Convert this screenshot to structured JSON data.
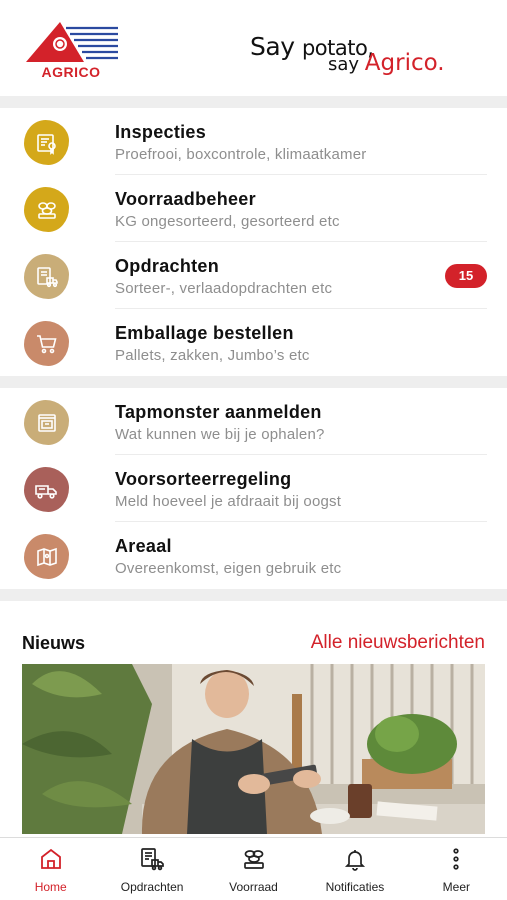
{
  "brand": {
    "logo_text": "AGRICO",
    "slogan_line1_a": "Say",
    "slogan_line1_b": "potato,",
    "slogan_line2_a": "say",
    "slogan_line2_b": "Agrico.",
    "accent_color": "#d3222a"
  },
  "groups": [
    {
      "items": [
        {
          "title": "Inspecties",
          "subtitle": "Proefrooi, boxcontrole, klimaatkamer",
          "icon": "inspection-certificate-icon",
          "color": "#d4a81a"
        },
        {
          "title": "Voorraadbeheer",
          "subtitle": "KG ongesorteerd, gesorteerd etc",
          "icon": "potato-stack-icon",
          "color": "#d4a81a"
        },
        {
          "title": "Opdrachten",
          "subtitle": "Sorteer-, verlaadopdrachten etc",
          "icon": "document-truck-icon",
          "color": "#c9ad78",
          "badge": "15"
        },
        {
          "title": "Emballage bestellen",
          "subtitle": "Pallets, zakken, Jumbo’s etc",
          "icon": "shopping-cart-icon",
          "color": "#c98a6a"
        }
      ]
    },
    {
      "items": [
        {
          "title": "Tapmonster aanmelden",
          "subtitle": "Wat kunnen we bij je ophalen?",
          "icon": "sample-box-icon",
          "color": "#c9ad78"
        },
        {
          "title": "Voorsorteerregeling",
          "subtitle": "Meld hoeveel je afdraait bij oogst",
          "icon": "dump-truck-icon",
          "color": "#a9605a"
        },
        {
          "title": "Areaal",
          "subtitle": "Overeenkomst, eigen gebruik etc",
          "icon": "map-icon",
          "color": "#c98a6a"
        }
      ]
    }
  ],
  "news": {
    "title": "Nieuws",
    "all_link": "Alle nieuwsberichten"
  },
  "tabs": [
    {
      "label": "Home",
      "icon": "home-icon",
      "active": true
    },
    {
      "label": "Opdrachten",
      "icon": "document-truck-icon",
      "active": false
    },
    {
      "label": "Voorraad",
      "icon": "potato-stack-icon",
      "active": false
    },
    {
      "label": "Notificaties",
      "icon": "bell-icon",
      "active": false
    },
    {
      "label": "Meer",
      "icon": "more-vertical-icon",
      "active": false
    }
  ]
}
